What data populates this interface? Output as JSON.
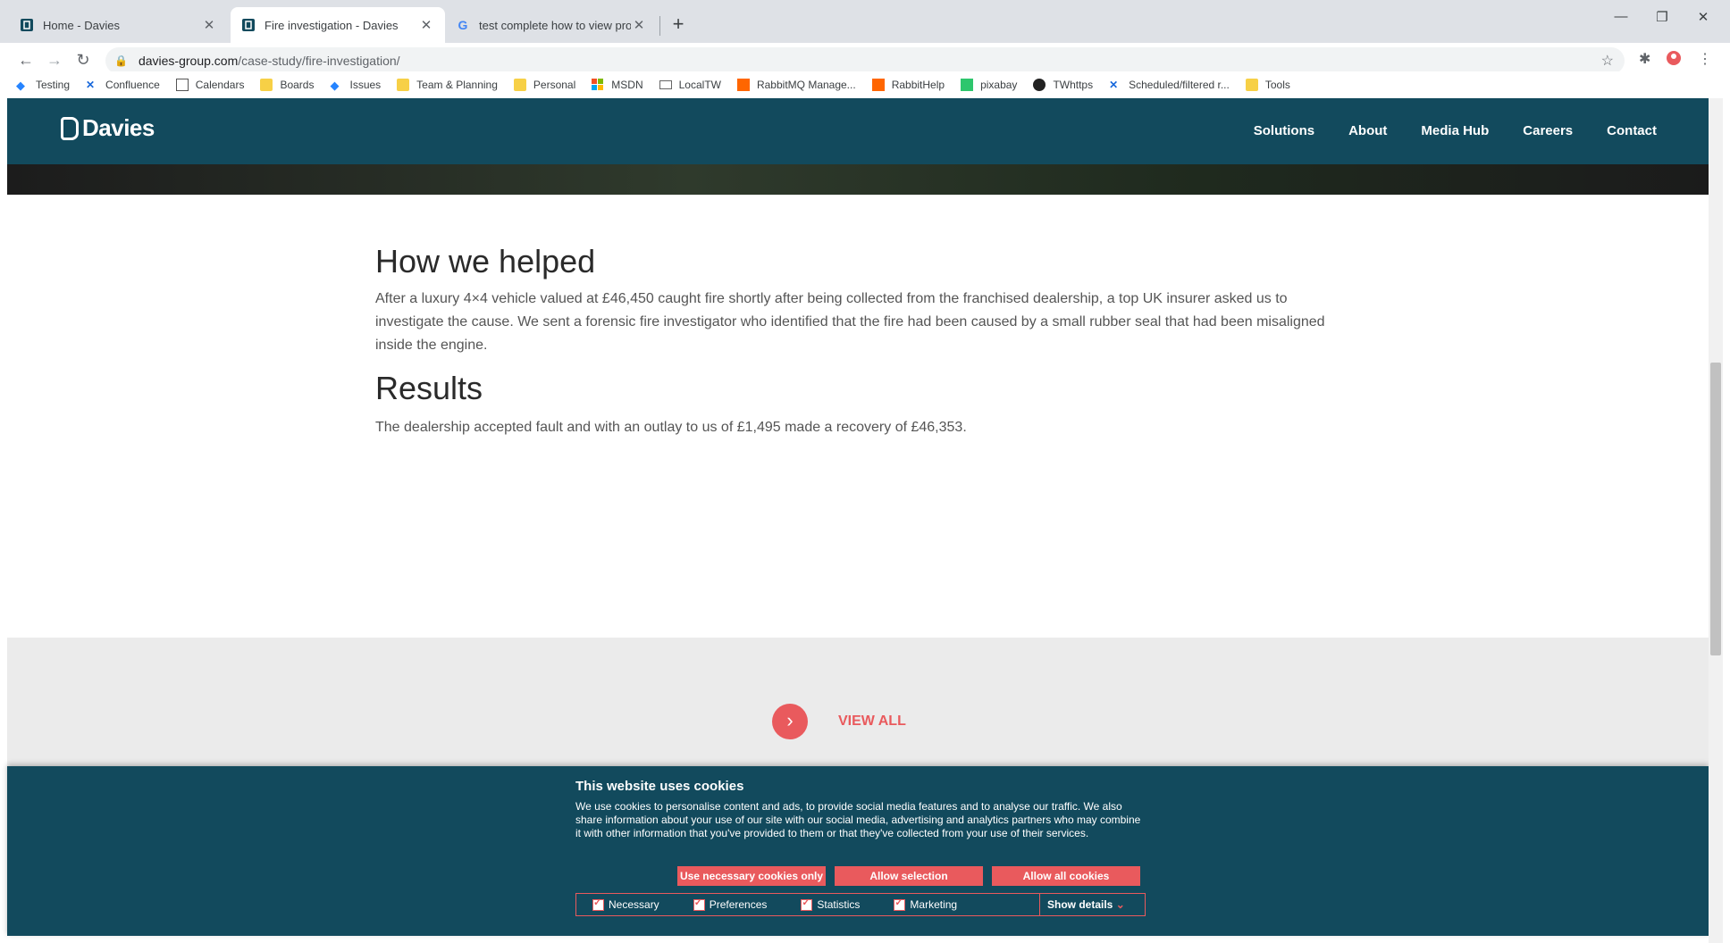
{
  "browser": {
    "tabs": [
      {
        "title": "Home - Davies",
        "icon": "davies-favicon"
      },
      {
        "title": "Fire investigation - Davies",
        "icon": "davies-favicon"
      },
      {
        "title": "test complete how to view projec",
        "icon": "google-favicon"
      }
    ],
    "url_domain": "davies-group.com",
    "url_path": "/case-study/fire-investigation/",
    "bookmarks": [
      {
        "label": "Testing",
        "icon": "jira-icon"
      },
      {
        "label": "Confluence",
        "icon": "confluence-icon"
      },
      {
        "label": "Calendars",
        "icon": "calendar-icon"
      },
      {
        "label": "Boards",
        "icon": "folder-icon"
      },
      {
        "label": "Issues",
        "icon": "jira-icon"
      },
      {
        "label": "Team & Planning",
        "icon": "folder-icon"
      },
      {
        "label": "Personal",
        "icon": "folder-icon"
      },
      {
        "label": "MSDN",
        "icon": "microsoft-icon"
      },
      {
        "label": "LocalTW",
        "icon": "laptop-icon"
      },
      {
        "label": "RabbitMQ Manage...",
        "icon": "rabbitmq-icon"
      },
      {
        "label": "RabbitHelp",
        "icon": "rabbitmq-icon"
      },
      {
        "label": "pixabay",
        "icon": "pixabay-icon"
      },
      {
        "label": "TWhttps",
        "icon": "info-icon"
      },
      {
        "label": "Scheduled/filtered r...",
        "icon": "confluence-icon"
      },
      {
        "label": "Tools",
        "icon": "folder-icon"
      }
    ]
  },
  "site": {
    "logo": "Davies",
    "nav": [
      "Solutions",
      "About",
      "Media Hub",
      "Careers",
      "Contact"
    ]
  },
  "content": {
    "heading1": "How we helped",
    "para1": "After a luxury 4×4 vehicle valued at £46,450 caught fire shortly after being collected from the franchised dealership, a top UK insurer asked us to investigate the cause. We sent a forensic fire investigator who identified that the fire had been caused by a small rubber seal that had been misaligned inside the engine.",
    "heading2": "Results",
    "para2": "The dealership accepted fault and with an outlay to us of £1,495 made a recovery of £46,353.",
    "view_all": "VIEW ALL"
  },
  "cookie": {
    "title": "This website uses cookies",
    "body": "We use cookies to personalise content and ads, to provide social media features and to analyse our traffic. We also share information about your use of our site with our social media, advertising and analytics partners who may combine it with other information that you've provided to them or that they've collected from your use of their services.",
    "btn_necessary": "Use necessary cookies only",
    "btn_selection": "Allow selection",
    "btn_all": "Allow all cookies",
    "options": [
      "Necessary",
      "Preferences",
      "Statistics",
      "Marketing"
    ],
    "show_details": "Show details"
  },
  "colors": {
    "brand": "#124a5d",
    "accent": "#e95a5d"
  }
}
